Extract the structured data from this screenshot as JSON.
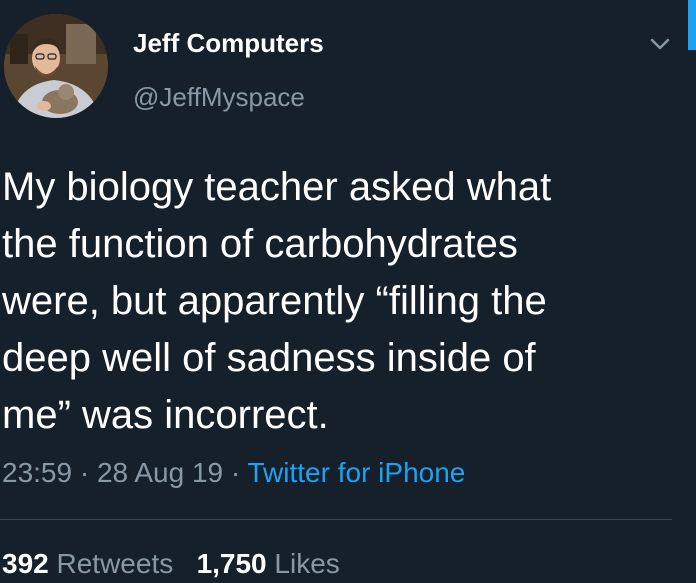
{
  "tweet": {
    "author": {
      "name": "Jeff Computers",
      "handle": "@JeffMyspace"
    },
    "text_lines": [
      "My biology teacher asked what",
      "the function of carbohydrates",
      "were, but apparently “filling the",
      "deep well of sadness inside of",
      "me” was incorrect."
    ],
    "time": "23:59",
    "date": "28 Aug 19",
    "separator": "·",
    "source": "Twitter for iPhone",
    "stats": {
      "retweets_count": "392",
      "retweets_label": "Retweets",
      "likes_count": "1,750",
      "likes_label": "Likes"
    }
  },
  "icons": {
    "menu": "chevron-down-icon"
  },
  "colors": {
    "background": "#15202b",
    "text": "#ffffff",
    "secondary": "#8899a6",
    "accent": "#1da1f2",
    "divider": "#38444d"
  }
}
